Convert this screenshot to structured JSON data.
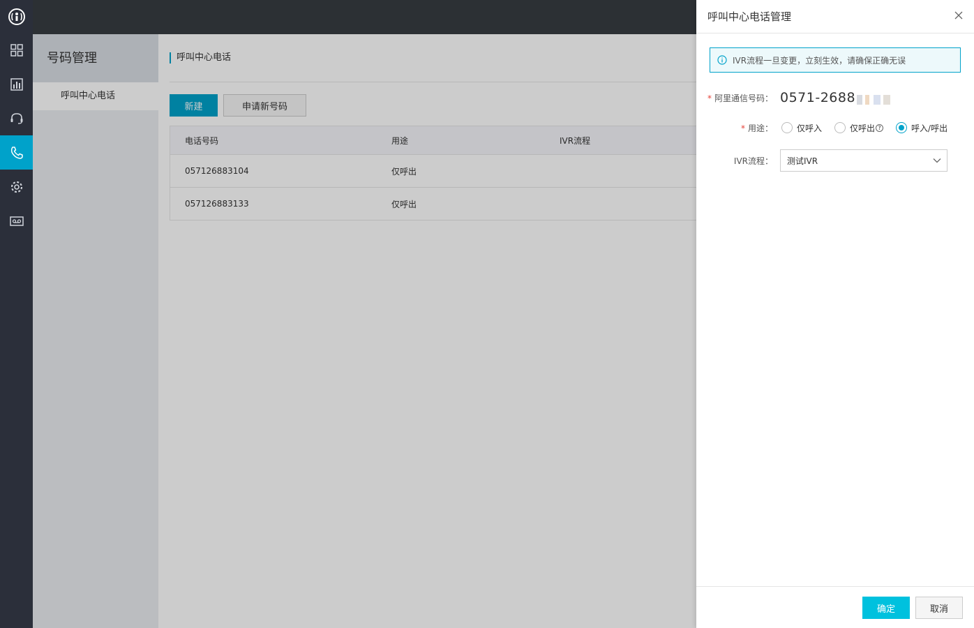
{
  "sidebar": {
    "items": [
      {
        "icon": "dashboard-icon"
      },
      {
        "icon": "chart-icon"
      },
      {
        "icon": "headset-icon"
      },
      {
        "icon": "phone-icon",
        "active": true
      },
      {
        "icon": "gear-icon"
      },
      {
        "icon": "voicemail-icon"
      }
    ]
  },
  "subnav": {
    "title": "号码管理",
    "items": [
      "呼叫中心电话"
    ]
  },
  "main": {
    "page_title": "呼叫中心电话",
    "new_button": "新建",
    "apply_button": "申请新号码",
    "table": {
      "headers": [
        "电话号码",
        "用途",
        "IVR流程"
      ],
      "rows": [
        [
          "057126883104",
          "仅呼出",
          ""
        ],
        [
          "057126883133",
          "仅呼出",
          ""
        ]
      ]
    }
  },
  "drawer": {
    "title": "呼叫中心电话管理",
    "notice": "IVR流程一旦变更，立刻生效，请确保正确无误",
    "number_label": "阿里通信号码：",
    "number_value": "0571-2688",
    "usage_label": "用途：",
    "usage_options": [
      "仅呼入",
      "仅呼出",
      "呼入/呼出"
    ],
    "usage_selected": "呼入/呼出",
    "ivr_label": "IVR流程：",
    "ivr_value": "测试IVR",
    "ok_button": "确定",
    "cancel_button": "取消"
  },
  "colors": {
    "accent": "#00a2ca",
    "rail": "#2b2f3a",
    "topbar": "#373d41",
    "ok_button": "#00c1de"
  }
}
